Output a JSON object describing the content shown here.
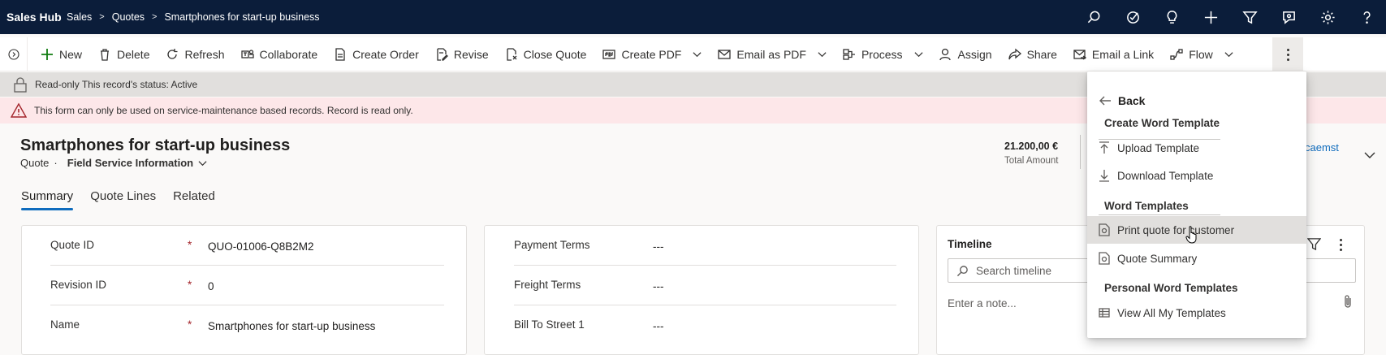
{
  "app": {
    "title": "Sales Hub"
  },
  "breadcrumb": [
    "Sales",
    "Quotes",
    "Smartphones for start-up business"
  ],
  "top_icons": [
    "search-icon",
    "task-check-icon",
    "lightbulb-icon",
    "plus-icon",
    "filter-icon",
    "assistant-icon",
    "gear-icon",
    "help-icon"
  ],
  "commands": [
    {
      "label": "New",
      "icon": "plus-icon"
    },
    {
      "label": "Delete",
      "icon": "trash-icon"
    },
    {
      "label": "Refresh",
      "icon": "refresh-icon"
    },
    {
      "label": "Collaborate",
      "icon": "teams-icon"
    },
    {
      "label": "Create Order",
      "icon": "document-icon"
    },
    {
      "label": "Revise",
      "icon": "edit-document-icon"
    },
    {
      "label": "Close Quote",
      "icon": "close-document-icon"
    },
    {
      "label": "Create PDF",
      "icon": "pdf-icon",
      "split": true
    },
    {
      "label": "Email as PDF",
      "icon": "mail-icon",
      "split": true
    },
    {
      "label": "Process",
      "icon": "process-icon",
      "split": true
    },
    {
      "label": "Assign",
      "icon": "person-icon"
    },
    {
      "label": "Share",
      "icon": "share-icon"
    },
    {
      "label": "Email a Link",
      "icon": "mail-link-icon"
    },
    {
      "label": "Flow",
      "icon": "flow-icon",
      "split": true
    }
  ],
  "readonly_notice": "Read-only This record's status: Active",
  "warning_notice": "This form can only be used on service-maintenance based records. Record is read only.",
  "record": {
    "title": "Smartphones for start-up business",
    "entity": "Quote",
    "form": "Field Service Information",
    "amount_value": "21.200,00 €",
    "amount_label": "Total Amount",
    "owner_fragment": "caemst"
  },
  "tabs": [
    "Summary",
    "Quote Lines",
    "Related"
  ],
  "card1_fields": [
    {
      "label": "Quote ID",
      "value": "QUO-01006-Q8B2M2",
      "required": "*"
    },
    {
      "label": "Revision ID",
      "value": "0",
      "required": "*"
    },
    {
      "label": "Name",
      "value": "Smartphones for start-up business",
      "required": "*"
    }
  ],
  "card2_fields": [
    {
      "label": "Payment Terms",
      "value": "---"
    },
    {
      "label": "Freight Terms",
      "value": "---"
    },
    {
      "label": "Bill To Street 1",
      "value": "---"
    }
  ],
  "timeline": {
    "title": "Timeline",
    "search_placeholder": "Search timeline",
    "note_placeholder": "Enter a note..."
  },
  "flyout": {
    "back": "Back",
    "create_header": "Create Word Template",
    "upload": "Upload Template",
    "download": "Download Template",
    "word_header": "Word Templates",
    "print_quote": "Print quote for customer",
    "quote_summary": "Quote Summary",
    "personal_header": "Personal Word Templates",
    "view_all": "View All My Templates"
  },
  "colors": {
    "topbar": "#0b1d3a",
    "accent": "#0f6cbd",
    "warning_bg": "#fde7e9",
    "warning_icon": "#a4262c"
  }
}
